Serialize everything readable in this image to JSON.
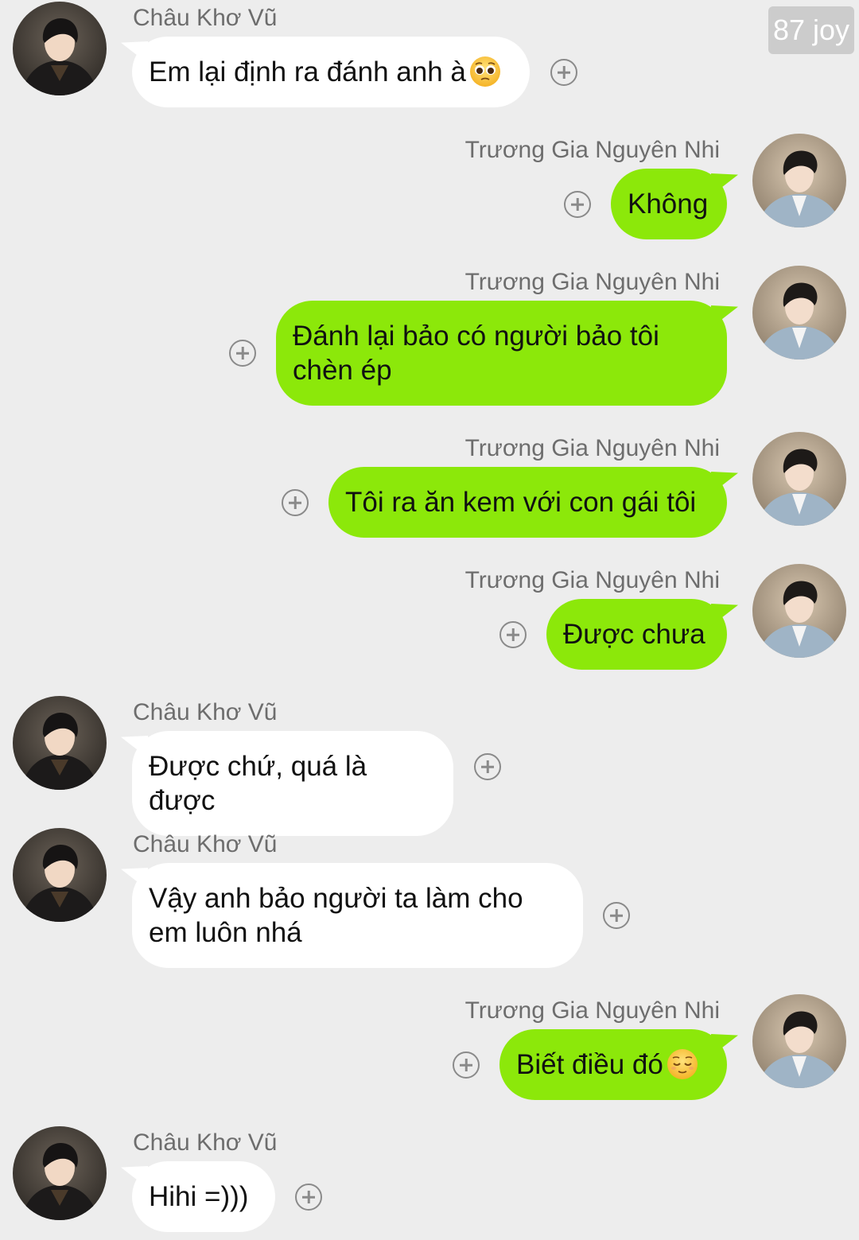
{
  "watermark": "87 joy",
  "contacts": {
    "left_name": "Châu Khơ Vũ",
    "right_name": "Trương Gia Nguyên Nhi"
  },
  "messages": [
    {
      "side": "left",
      "sender": "Châu Khơ Vũ",
      "text": "Em lại định ra đánh anh à",
      "emoji": "pleading-face-icon"
    },
    {
      "side": "right",
      "sender": "Trương Gia Nguyên Nhi",
      "text": "Không"
    },
    {
      "side": "right",
      "sender": "Trương Gia Nguyên Nhi",
      "text": "Đánh lại bảo có người bảo tôi chèn ép"
    },
    {
      "side": "right",
      "sender": "Trương Gia Nguyên Nhi",
      "text": "Tôi ra ăn kem với con gái tôi"
    },
    {
      "side": "right",
      "sender": "Trương Gia Nguyên Nhi",
      "text": "Được chưa"
    },
    {
      "side": "left",
      "sender": "Châu Khơ Vũ",
      "text": "Được chứ, quá là được"
    },
    {
      "side": "left",
      "sender": "Châu Khơ Vũ",
      "text": "Vậy anh bảo người ta làm cho em luôn nhá"
    },
    {
      "side": "right",
      "sender": "Trương Gia Nguyên Nhi",
      "text": "Biết điều đó",
      "emoji": "relieved-face-icon"
    },
    {
      "side": "left",
      "sender": "Châu Khơ Vũ",
      "text": "Hihi =)))"
    }
  ]
}
